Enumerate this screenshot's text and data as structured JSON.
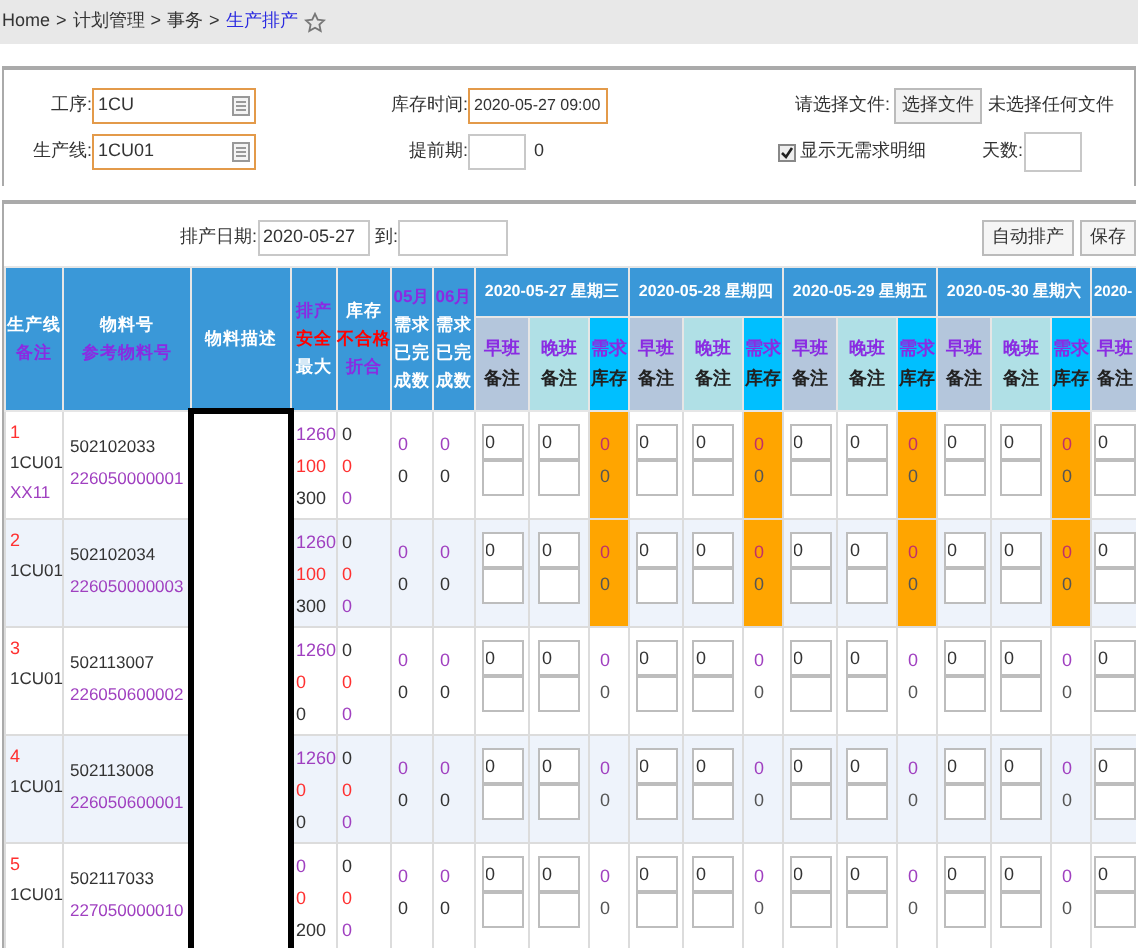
{
  "breadcrumb": {
    "items": [
      "Home",
      "计划管理",
      "事务",
      "生产排产"
    ],
    "separator": ">"
  },
  "filters": {
    "process": {
      "label": "工序:",
      "value": "1CU"
    },
    "line": {
      "label": "生产线:",
      "value": "1CU01"
    },
    "stock_time": {
      "label": "库存时间:",
      "value": "2020-05-27 09:00"
    },
    "lead_time": {
      "label": "提前期:",
      "after": "0"
    },
    "file": {
      "label": "请选择文件:",
      "button": "选择文件",
      "status": "未选择任何文件"
    },
    "show_no_demand": {
      "label": "显示无需求明细",
      "checked": true
    },
    "days": {
      "label": "天数:"
    }
  },
  "toolbar": {
    "from_label": "排产日期:",
    "from_value": "2020-05-27",
    "to_label": "到:",
    "buttons": [
      "自动排产",
      "保存"
    ]
  },
  "columns": [
    {
      "lines": [
        {
          "text": "生产线",
          "color": "#ffffff"
        },
        {
          "text": "备注",
          "color": "#8a2be2"
        }
      ]
    },
    {
      "lines": [
        {
          "text": "物料号",
          "color": "#ffffff"
        },
        {
          "text": "参考物料号",
          "color": "#8a2be2"
        }
      ]
    },
    {
      "lines": [
        {
          "text": "物料描述",
          "color": "#ffffff"
        }
      ]
    },
    {
      "lines": [
        {
          "text": "排产",
          "color": "#8a2be2"
        },
        {
          "text": "安全",
          "color": "#ff0000"
        },
        {
          "text": "最大",
          "color": "#ffffff"
        }
      ]
    },
    {
      "lines": [
        {
          "text": "库存",
          "color": "#ffffff"
        },
        {
          "text": "不合格",
          "color": "#ff0000"
        },
        {
          "text": "折合",
          "color": "#8a2be2"
        }
      ]
    },
    {
      "lines": [
        {
          "text": "05月",
          "color": "#8a2be2"
        },
        {
          "text": "需求",
          "color": "#ffffff"
        },
        {
          "text": "已完",
          "color": "#ffffff"
        },
        {
          "text": "成数",
          "color": "#ffffff"
        }
      ]
    },
    {
      "lines": [
        {
          "text": "06月",
          "color": "#8a2be2"
        },
        {
          "text": "需求",
          "color": "#ffffff"
        },
        {
          "text": "已完",
          "color": "#ffffff"
        },
        {
          "text": "成数",
          "color": "#ffffff"
        }
      ]
    }
  ],
  "days": [
    {
      "date": "2020-05-27 星期三",
      "shifts": [
        {
          "kind": "early",
          "top": "早班",
          "bottom": "备注"
        },
        {
          "kind": "late",
          "top": "晚班",
          "bottom": "备注"
        },
        {
          "kind": "demand",
          "top": "需求",
          "bottom": "库存"
        }
      ]
    },
    {
      "date": "2020-05-28 星期四",
      "shifts": [
        {
          "kind": "early",
          "top": "早班",
          "bottom": "备注"
        },
        {
          "kind": "late",
          "top": "晚班",
          "bottom": "备注"
        },
        {
          "kind": "demand",
          "top": "需求",
          "bottom": "库存"
        }
      ]
    },
    {
      "date": "2020-05-29 星期五",
      "shifts": [
        {
          "kind": "early",
          "top": "早班",
          "bottom": "备注"
        },
        {
          "kind": "late",
          "top": "晚班",
          "bottom": "备注"
        },
        {
          "kind": "demand",
          "top": "需求",
          "bottom": "库存"
        }
      ]
    },
    {
      "date": "2020-05-30 星期六",
      "shifts": [
        {
          "kind": "early",
          "top": "早班",
          "bottom": "备注"
        },
        {
          "kind": "late",
          "top": "晚班",
          "bottom": "备注"
        },
        {
          "kind": "demand",
          "top": "需求",
          "bottom": "库存"
        }
      ]
    },
    {
      "date": "2020-",
      "shifts": [
        {
          "kind": "early",
          "top": "早班",
          "bottom": "备注"
        }
      ]
    }
  ],
  "rows": [
    {
      "no": "1",
      "line": "1CU01",
      "note": "XX11",
      "material": "502102033",
      "ref": "226050000001",
      "plan": [
        "1260",
        "100",
        "300"
      ],
      "stock": [
        "0",
        "0",
        "0"
      ],
      "may": [
        "0",
        "0"
      ],
      "june": [
        "0",
        "0"
      ],
      "days": [
        {
          "early": "0",
          "late": "0",
          "demand": "0",
          "stock": "0",
          "short": true
        },
        {
          "early": "0",
          "late": "0",
          "demand": "0",
          "stock": "0",
          "short": true
        },
        {
          "early": "0",
          "late": "0",
          "demand": "0",
          "stock": "0",
          "short": true
        },
        {
          "early": "0",
          "late": "0",
          "demand": "0",
          "stock": "0",
          "short": true
        },
        {
          "early": "0"
        }
      ]
    },
    {
      "no": "2",
      "line": "1CU01",
      "material": "502102034",
      "ref": "226050000003",
      "plan": [
        "1260",
        "100",
        "300"
      ],
      "stock": [
        "0",
        "0",
        "0"
      ],
      "may": [
        "0",
        "0"
      ],
      "june": [
        "0",
        "0"
      ],
      "days": [
        {
          "early": "0",
          "late": "0",
          "demand": "0",
          "stock": "0",
          "short": true
        },
        {
          "early": "0",
          "late": "0",
          "demand": "0",
          "stock": "0",
          "short": true
        },
        {
          "early": "0",
          "late": "0",
          "demand": "0",
          "stock": "0",
          "short": true
        },
        {
          "early": "0",
          "late": "0",
          "demand": "0",
          "stock": "0",
          "short": true
        },
        {
          "early": "0"
        }
      ]
    },
    {
      "no": "3",
      "line": "1CU01",
      "material": "502113007",
      "ref": "226050600002",
      "plan": [
        "1260",
        "0",
        "0"
      ],
      "stock": [
        "0",
        "0",
        "0"
      ],
      "may": [
        "0",
        "0"
      ],
      "june": [
        "0",
        "0"
      ],
      "days": [
        {
          "early": "0",
          "late": "0",
          "demand": "0",
          "stock": "0",
          "short": false
        },
        {
          "early": "0",
          "late": "0",
          "demand": "0",
          "stock": "0",
          "short": false
        },
        {
          "early": "0",
          "late": "0",
          "demand": "0",
          "stock": "0",
          "short": false
        },
        {
          "early": "0",
          "late": "0",
          "demand": "0",
          "stock": "0",
          "short": false
        },
        {
          "early": "0"
        }
      ]
    },
    {
      "no": "4",
      "line": "1CU01",
      "material": "502113008",
      "ref": "226050600001",
      "plan": [
        "1260",
        "0",
        "0"
      ],
      "stock": [
        "0",
        "0",
        "0"
      ],
      "may": [
        "0",
        "0"
      ],
      "june": [
        "0",
        "0"
      ],
      "days": [
        {
          "early": "0",
          "late": "0",
          "demand": "0",
          "stock": "0",
          "short": false
        },
        {
          "early": "0",
          "late": "0",
          "demand": "0",
          "stock": "0",
          "short": false
        },
        {
          "early": "0",
          "late": "0",
          "demand": "0",
          "stock": "0",
          "short": false
        },
        {
          "early": "0",
          "late": "0",
          "demand": "0",
          "stock": "0",
          "short": false
        },
        {
          "early": "0"
        }
      ]
    },
    {
      "no": "5",
      "line": "1CU01",
      "material": "502117033",
      "ref": "227050000010",
      "plan": [
        "0",
        "0",
        "200"
      ],
      "stock": [
        "0",
        "0",
        "0"
      ],
      "may": [
        "0",
        "0"
      ],
      "june": [
        "0",
        "0"
      ],
      "days": [
        {
          "early": "0",
          "late": "0",
          "demand": "0",
          "stock": "0",
          "short": false
        },
        {
          "early": "0",
          "late": "0",
          "demand": "0",
          "stock": "0",
          "short": false
        },
        {
          "early": "0",
          "late": "0",
          "demand": "0",
          "stock": "0",
          "short": false
        },
        {
          "early": "0",
          "late": "0",
          "demand": "0",
          "stock": "0",
          "short": false
        },
        {
          "early": "0"
        }
      ]
    }
  ]
}
